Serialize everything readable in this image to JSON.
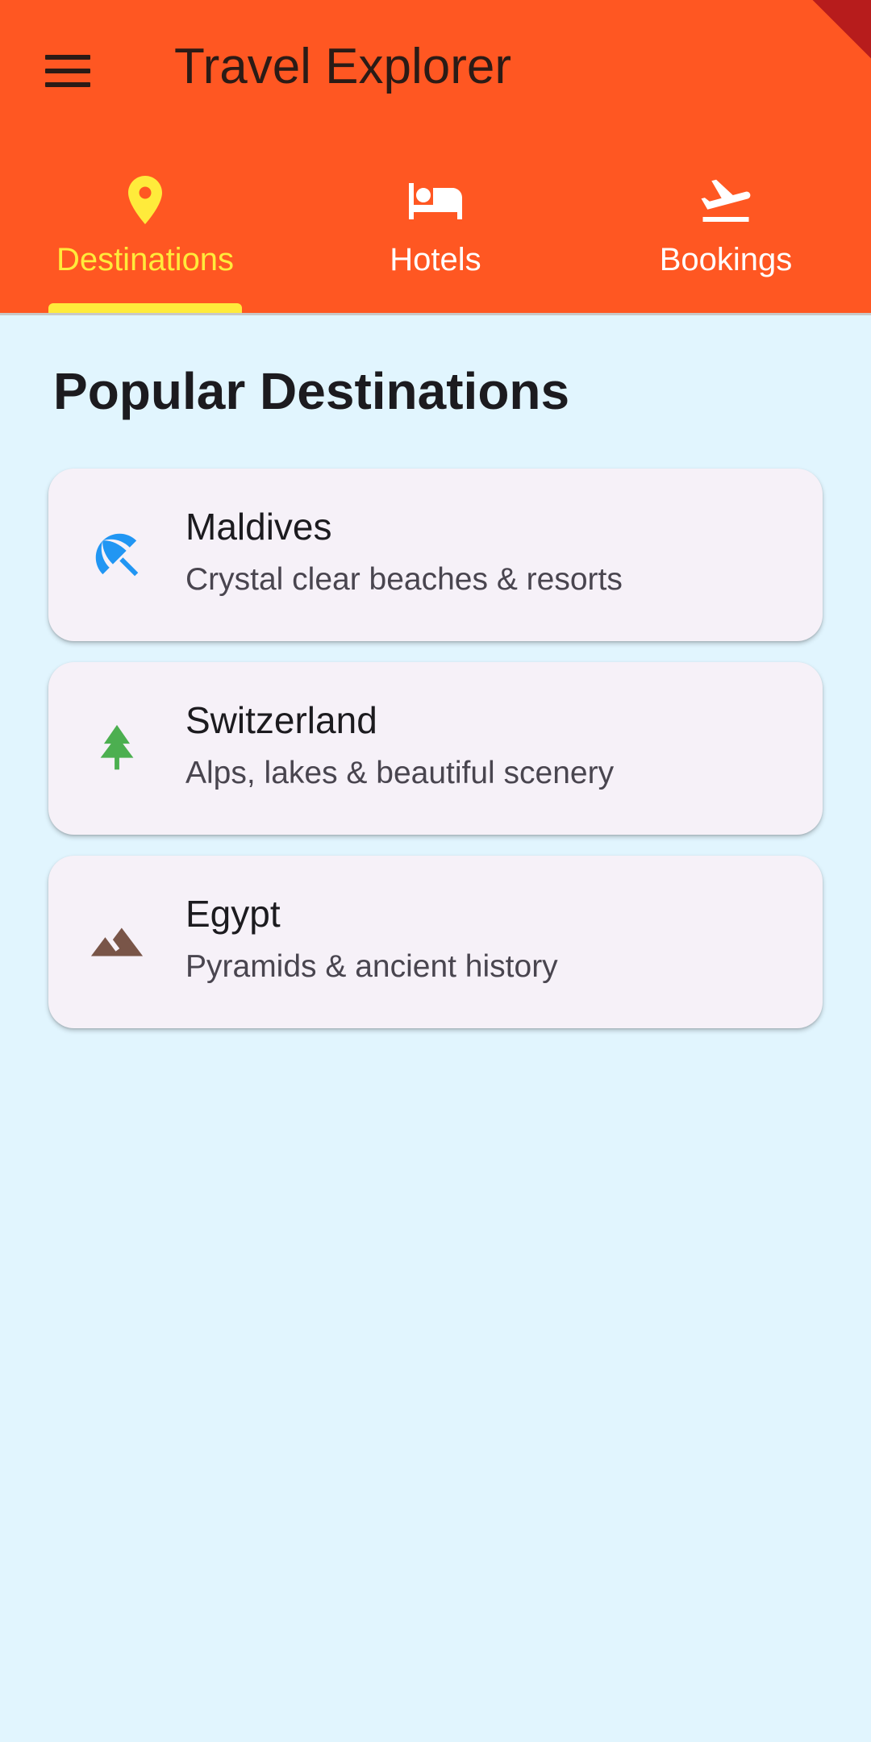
{
  "app_bar": {
    "title": "Travel Explorer",
    "menu_icon": "menu-icon",
    "background_color": "#ff5722"
  },
  "tabs": [
    {
      "label": "Destinations",
      "icon": "location-pin-icon",
      "active": true
    },
    {
      "label": "Hotels",
      "icon": "bed-icon",
      "active": false
    },
    {
      "label": "Bookings",
      "icon": "flight-takeoff-icon",
      "active": false
    }
  ],
  "colors": {
    "active_tab": "#ffeb3b",
    "inactive_tab": "#ffffff",
    "content_background": "#e1f5fe",
    "card_background": "#f6f1f8"
  },
  "main": {
    "section_title": "Popular Destinations",
    "destinations": [
      {
        "name": "Maldives",
        "description": "Crystal clear beaches & resorts",
        "icon": "beach-umbrella-icon",
        "icon_color": "#2196f3"
      },
      {
        "name": "Switzerland",
        "description": "Alps, lakes & beautiful scenery",
        "icon": "pine-tree-icon",
        "icon_color": "#4caf50"
      },
      {
        "name": "Egypt",
        "description": "Pyramids & ancient history",
        "icon": "landscape-icon",
        "icon_color": "#795548"
      }
    ]
  }
}
